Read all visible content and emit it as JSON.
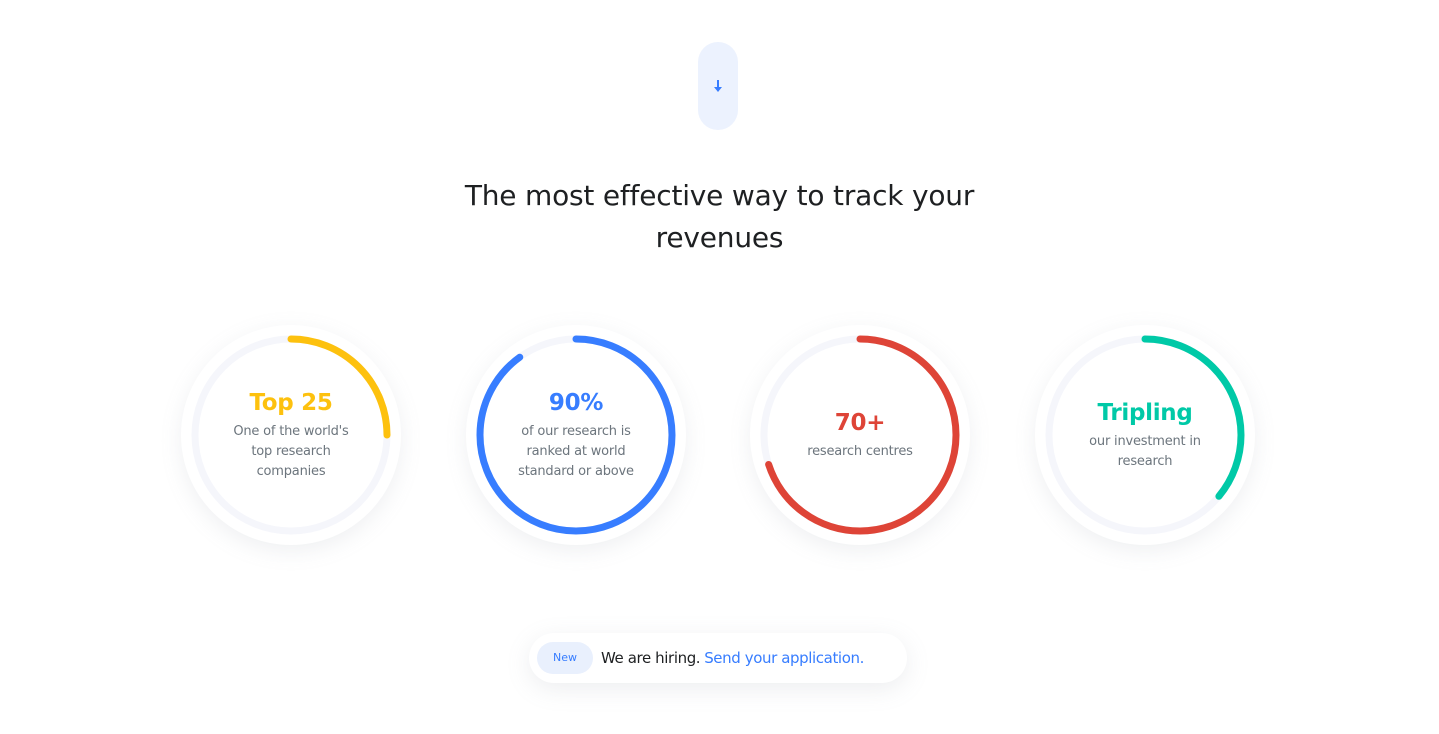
{
  "scroll_button": {
    "icon": "arrow-down-icon",
    "accent": "#377dff"
  },
  "headline": "The most effective way to track your revenues",
  "stats": [
    {
      "value": "Top 25",
      "description": "One of the world's top research companies",
      "color": "#fdc10e",
      "progress": 0.25
    },
    {
      "value": "90%",
      "description": "of our research is ranked at world standard or above",
      "color": "#377dff",
      "progress": 0.9
    },
    {
      "value": "70+",
      "description": "research centres",
      "color": "#de4437",
      "progress": 0.7
    },
    {
      "value": "Tripling",
      "description": "our investment in research",
      "color": "#00c9a7",
      "progress": 0.36
    }
  ],
  "hiring": {
    "badge": "New",
    "text": "We are hiring.",
    "link": "Send your application."
  },
  "colors": {
    "track": "#f5f6fb",
    "text_dark": "#1e2022",
    "text_muted": "#6c757d",
    "badge_bg": "#e9f0fd"
  }
}
